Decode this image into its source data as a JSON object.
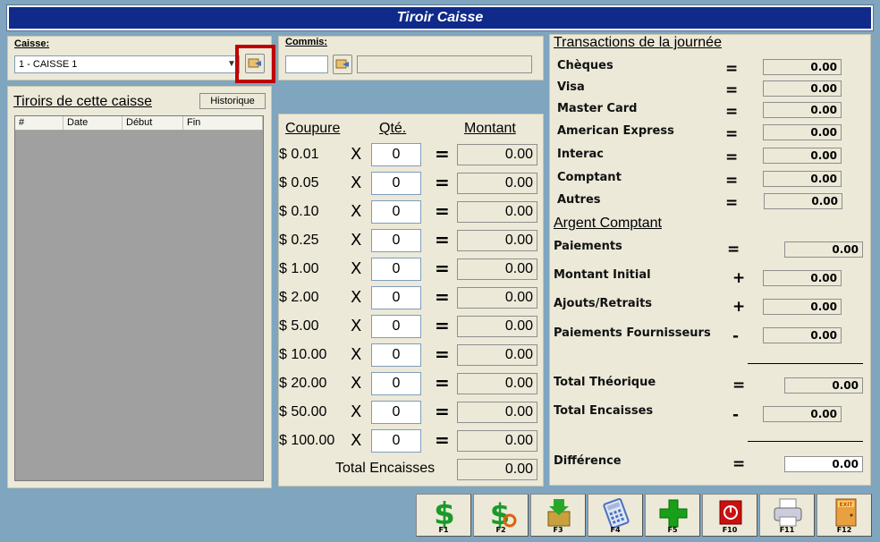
{
  "window": {
    "title": "Tiroir Caisse"
  },
  "caisse": {
    "label": "Caisse:",
    "selected": "1 - CAISSE 1"
  },
  "commis": {
    "label": "Commis:",
    "value": "",
    "name": ""
  },
  "tiroirs": {
    "title": "Tiroirs de cette caisse",
    "history_button": "Historique",
    "columns": [
      "#",
      "Date",
      "Début",
      "Fin"
    ]
  },
  "coupures": {
    "header_coupure": "Coupure",
    "header_qty": "Qté.",
    "header_montant": "Montant",
    "rows": [
      {
        "label": "$  0.01",
        "qty": "0",
        "amount": "0.00"
      },
      {
        "label": "$  0.05",
        "qty": "0",
        "amount": "0.00"
      },
      {
        "label": "$  0.10",
        "qty": "0",
        "amount": "0.00"
      },
      {
        "label": "$  0.25",
        "qty": "0",
        "amount": "0.00"
      },
      {
        "label": "$  1.00",
        "qty": "0",
        "amount": "0.00"
      },
      {
        "label": "$  2.00",
        "qty": "0",
        "amount": "0.00"
      },
      {
        "label": "$  5.00",
        "qty": "0",
        "amount": "0.00"
      },
      {
        "label": "$  10.00",
        "qty": "0",
        "amount": "0.00"
      },
      {
        "label": "$  20.00",
        "qty": "0",
        "amount": "0.00"
      },
      {
        "label": "$  50.00",
        "qty": "0",
        "amount": "0.00"
      },
      {
        "label": "$  100.00",
        "qty": "0",
        "amount": "0.00"
      }
    ],
    "multiply_symbol": "X",
    "equals_symbol": "=",
    "total_label": "Total Encaisses",
    "total_value": "0.00"
  },
  "transactions": {
    "title": "Transactions de la journée",
    "rows": [
      {
        "label": "Chèques",
        "op": "=",
        "value": "0.00"
      },
      {
        "label": "Visa",
        "op": "=",
        "value": "0.00"
      },
      {
        "label": "Master Card",
        "op": "=",
        "value": "0.00"
      },
      {
        "label": "American Express",
        "op": "=",
        "value": "0.00"
      },
      {
        "label": "Interac",
        "op": "=",
        "value": "0.00"
      },
      {
        "label": "Comptant",
        "op": "=",
        "value": "0.00"
      },
      {
        "label": "Autres",
        "op": "=",
        "value": "0.00"
      }
    ]
  },
  "argent": {
    "title": "Argent Comptant",
    "paiements": {
      "label": "Paiements",
      "op": "=",
      "value": "0.00"
    },
    "montant_initial": {
      "label": "Montant Initial",
      "op": "+",
      "value": "0.00"
    },
    "ajouts": {
      "label": "Ajouts/Retraits",
      "op": "+",
      "value": "0.00"
    },
    "fournisseurs": {
      "label": "Paiements Fournisseurs",
      "op": "-",
      "value": "0.00"
    },
    "total_theorique": {
      "label": "Total Théorique",
      "op": "=",
      "value": "0.00"
    },
    "total_encaisses": {
      "label": "Total Encaisses",
      "op": "-",
      "value": "0.00"
    },
    "difference": {
      "label": "Différence",
      "op": "=",
      "value": "0.00"
    }
  },
  "toolbar": [
    {
      "key": "F1",
      "icon": "dollar-icon",
      "color": "#1a9a2a"
    },
    {
      "key": "F2",
      "icon": "dollar-refresh-icon",
      "color": "#1a9a2a"
    },
    {
      "key": "F3",
      "icon": "box-download-icon",
      "color": "#c8a040"
    },
    {
      "key": "F4",
      "icon": "calculator-icon",
      "color": "#4a70c0"
    },
    {
      "key": "F5",
      "icon": "plus-icon",
      "color": "#18a018"
    },
    {
      "key": "F10",
      "icon": "power-icon",
      "color": "#cc1010"
    },
    {
      "key": "F11",
      "icon": "printer-icon",
      "color": "#666666"
    },
    {
      "key": "F12",
      "icon": "exit-door-icon",
      "color": "#d04020"
    }
  ],
  "colors": {
    "title_bar": "#0f2a8a",
    "background": "#7fa5bf",
    "panel": "#ece9d8",
    "highlight_border": "#c00000"
  }
}
